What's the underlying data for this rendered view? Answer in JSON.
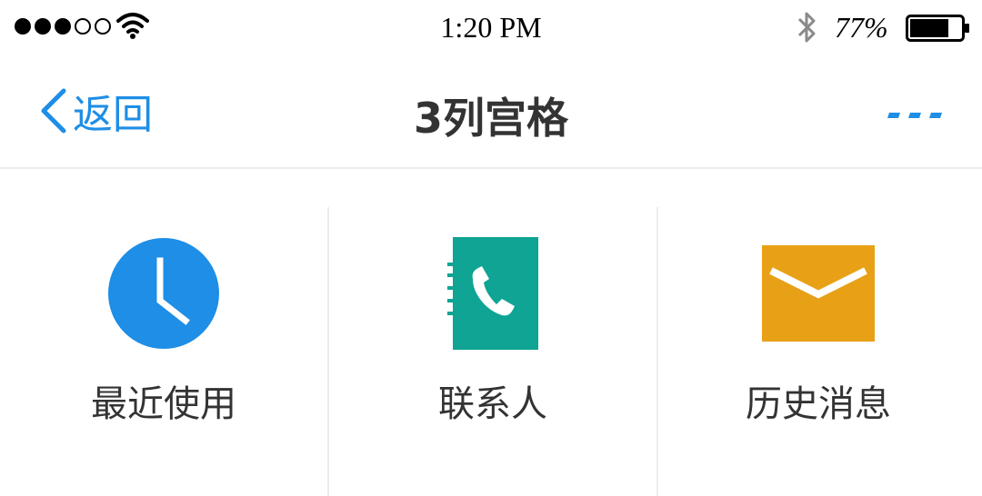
{
  "status_bar": {
    "time": "1:20 PM",
    "battery_percent": "77%",
    "battery_level": 0.77,
    "signal_strength": 3,
    "signal_total": 5
  },
  "nav": {
    "back_label": "返回",
    "title": "3列宫格",
    "accent_color": "#1e8ee6"
  },
  "grid": {
    "items": [
      {
        "label": "最近使用",
        "icon": "clock-icon",
        "color": "#1e8ee6"
      },
      {
        "label": "联系人",
        "icon": "contacts-book-icon",
        "color": "#0fa493"
      },
      {
        "label": "历史消息",
        "icon": "envelope-icon",
        "color": "#e8a116"
      }
    ]
  }
}
